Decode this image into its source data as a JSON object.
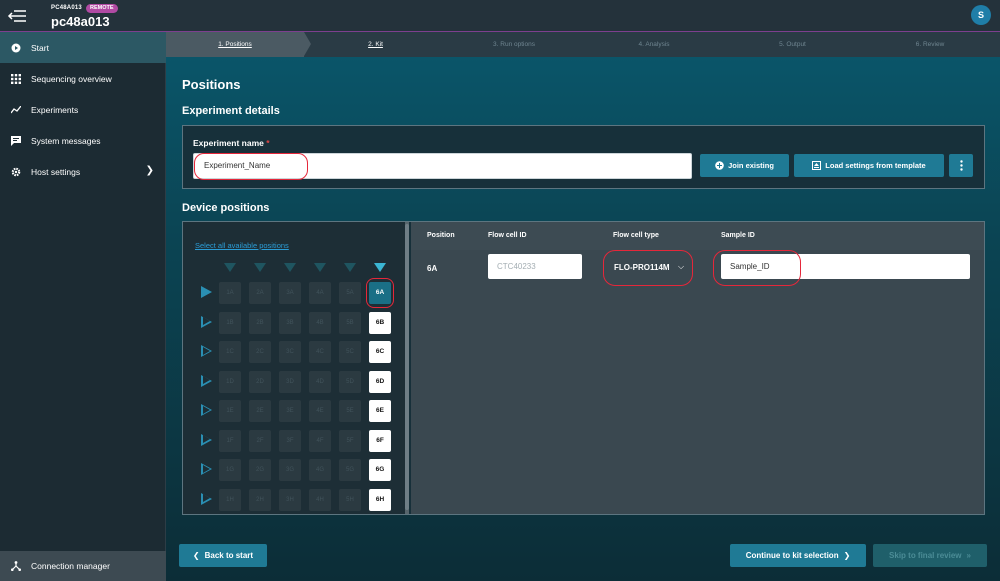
{
  "topbar": {
    "device_label": "PC48A013",
    "remote_badge": "REMOTE",
    "device_name": "pc48a013",
    "user_initial": "S"
  },
  "sidebar": {
    "items": [
      {
        "label": "Start",
        "icon": "play-circle-icon",
        "active": true
      },
      {
        "label": "Sequencing overview",
        "icon": "grid-icon"
      },
      {
        "label": "Experiments",
        "icon": "trend-icon"
      },
      {
        "label": "System messages",
        "icon": "message-icon"
      },
      {
        "label": "Host settings",
        "icon": "gear-icon"
      }
    ],
    "connection_manager": "Connection manager"
  },
  "steps": [
    "1. Positions",
    "2. Kit",
    "3. Run options",
    "4. Analysis",
    "5. Output",
    "6. Review"
  ],
  "main": {
    "page_title": "Positions",
    "experiment_details": {
      "heading": "Experiment details",
      "label": "Experiment name",
      "required_mark": "*",
      "value": "Experiment_Name",
      "join_existing": "Join existing",
      "load_template": "Load settings from template"
    },
    "device_positions": {
      "heading": "Device positions",
      "select_all": "Select all available positions",
      "grid_columns": [
        "1",
        "2",
        "3",
        "4",
        "5",
        "6"
      ],
      "grid_rows": [
        "A",
        "B",
        "C",
        "D",
        "E",
        "F",
        "G",
        "H"
      ],
      "available_column": "6",
      "selected_cell": "6A"
    },
    "table": {
      "headers": [
        "Position",
        "Flow cell ID",
        "Flow cell type",
        "Sample ID"
      ],
      "row": {
        "position": "6A",
        "flow_cell_id_placeholder": "CTC40233",
        "flow_cell_type": "FLO-PRO114M",
        "sample_id": "Sample_ID"
      }
    }
  },
  "footer": {
    "back": "Back to start",
    "continue": "Continue to kit selection",
    "skip": "Skip to final review"
  },
  "colors": {
    "accent": "#1f7a95",
    "remote_badge": "#b04aa3",
    "annotation": "#e5273a"
  }
}
